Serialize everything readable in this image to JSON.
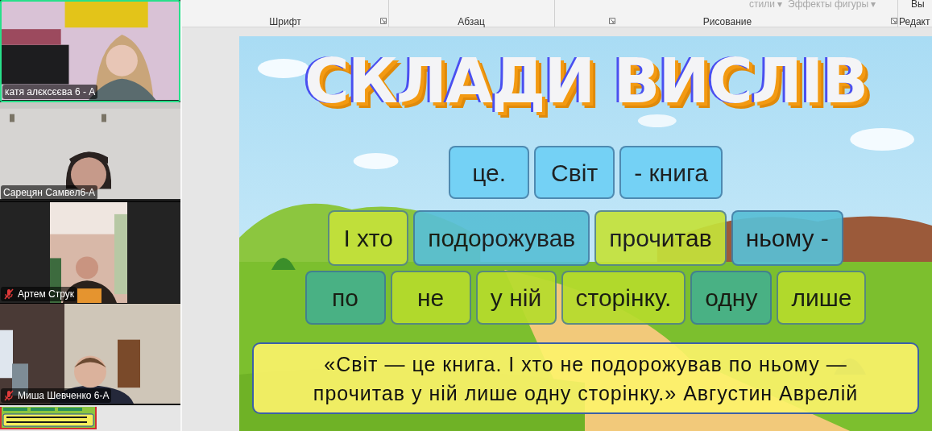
{
  "participants": [
    {
      "name": "катя алєксєєва 6 - А",
      "muted": false,
      "speaking": true
    },
    {
      "name": "Сарецян Самвел6-А",
      "muted": false,
      "speaking": false
    },
    {
      "name": "Артем Струк",
      "muted": true,
      "speaking": false
    },
    {
      "name": "Миша Шевченко 6-А",
      "muted": true,
      "speaking": false
    }
  ],
  "ribbon": {
    "groups": [
      "Шрифт",
      "Абзац",
      "Рисование",
      "Редакт"
    ],
    "fragments": [
      "стили ▾",
      "Эффекты фигуры ▾",
      "Вы"
    ]
  },
  "slide": {
    "title": "СКЛАДИ ВИСЛІВ",
    "rows": [
      {
        "tiles": [
          {
            "text": "це.",
            "color": "#6fd0f5"
          },
          {
            "text": "Світ",
            "color": "#6fd0f5"
          },
          {
            "text": "- книга",
            "color": "#6fd0f5"
          }
        ]
      },
      {
        "tiles": [
          {
            "text": "І хто",
            "color": "#c5e23a"
          },
          {
            "text": "подорожував",
            "color": "#58bfd6"
          },
          {
            "text": "прочитав",
            "color": "#c5e23a"
          },
          {
            "text": "ньому -",
            "color": "#58bfd6"
          }
        ]
      },
      {
        "tiles": [
          {
            "text": "по",
            "color": "#45b08c"
          },
          {
            "text": "не",
            "color": "#b6dc2c"
          },
          {
            "text": "у ній",
            "color": "#b6dc2c"
          },
          {
            "text": "сторінку.",
            "color": "#b6dc2c"
          },
          {
            "text": "одну",
            "color": "#45b08c"
          },
          {
            "text": "лише",
            "color": "#b6dc2c"
          }
        ]
      }
    ],
    "quote": [
      "«Світ — це книга. І хто не подорожував по ньому —",
      "прочитав у ній лише одну сторінку.» Августин Аврелій"
    ]
  }
}
